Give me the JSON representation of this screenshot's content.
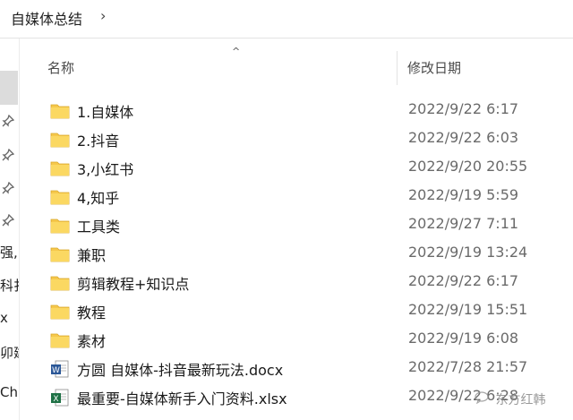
{
  "breadcrumb": {
    "path": "自媒体总结",
    "chevron": "›"
  },
  "columns": {
    "name": "名称",
    "date_modified": "修改日期",
    "sort_indicator": "^"
  },
  "nav_fragments": [
    "强,",
    "科扌",
    "x",
    "卯建",
    "Chi"
  ],
  "files": [
    {
      "name": "1.自媒体",
      "date": "2022/9/22 6:17",
      "type": "folder"
    },
    {
      "name": "2.抖音",
      "date": "2022/9/22 6:03",
      "type": "folder"
    },
    {
      "name": "3,小红书",
      "date": "2022/9/20 20:55",
      "type": "folder"
    },
    {
      "name": "4,知乎",
      "date": "2022/9/19 5:59",
      "type": "folder"
    },
    {
      "name": "工具类",
      "date": "2022/9/27 7:11",
      "type": "folder"
    },
    {
      "name": "兼职",
      "date": "2022/9/19 13:24",
      "type": "folder"
    },
    {
      "name": "剪辑教程+知识点",
      "date": "2022/9/22 6:17",
      "type": "folder"
    },
    {
      "name": "教程",
      "date": "2022/9/19 15:51",
      "type": "folder"
    },
    {
      "name": "素材",
      "date": "2022/9/19 6:08",
      "type": "folder"
    },
    {
      "name": "方圆 自媒体-抖音最新玩法.docx",
      "date": "2022/7/28 21:57",
      "type": "word"
    },
    {
      "name": "最重要-自媒体新手入门资料.xlsx",
      "date": "2022/9/22 6:28",
      "type": "excel"
    }
  ],
  "watermark": {
    "text": "东方红韩"
  },
  "colors": {
    "folder": "#f6c84c",
    "word": "#2b5797",
    "excel": "#1e7145"
  }
}
